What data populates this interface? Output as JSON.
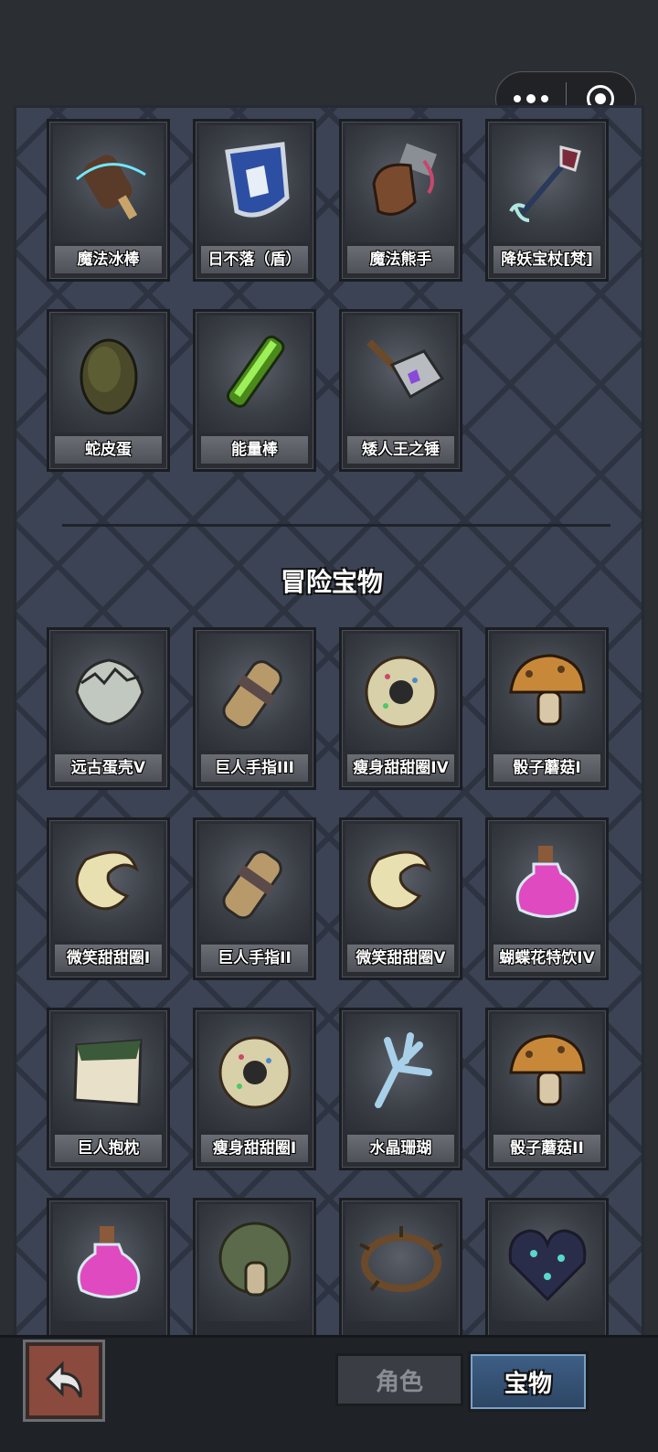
{
  "top_items": [
    {
      "label": "魔法冰棒",
      "icon": "ice-pop-icon"
    },
    {
      "label": "日不落（盾）",
      "icon": "shield-icon"
    },
    {
      "label": "魔法熊手",
      "icon": "bear-paw-icon"
    },
    {
      "label": "降妖宝杖[梵]",
      "icon": "staff-icon"
    },
    {
      "label": "蛇皮蛋",
      "icon": "snake-egg-icon"
    },
    {
      "label": "能量棒",
      "icon": "energy-bar-icon"
    },
    {
      "label": "矮人王之锤",
      "icon": "hammer-icon"
    }
  ],
  "section_title": "冒险宝物",
  "adventure_items": [
    {
      "label": "远古蛋壳V",
      "icon": "eggshell-icon"
    },
    {
      "label": "巨人手指III",
      "icon": "giant-finger-icon"
    },
    {
      "label": "瘦身甜甜圈IV",
      "icon": "donut-icon"
    },
    {
      "label": "骰子蘑菇I",
      "icon": "dice-mushroom-icon"
    },
    {
      "label": "微笑甜甜圈I",
      "icon": "smile-donut-icon"
    },
    {
      "label": "巨人手指II",
      "icon": "giant-finger-icon"
    },
    {
      "label": "微笑甜甜圈V",
      "icon": "smile-donut-icon"
    },
    {
      "label": "蝴蝶花特饮IV",
      "icon": "potion-icon"
    },
    {
      "label": "巨人抱枕",
      "icon": "pillow-icon"
    },
    {
      "label": "瘦身甜甜圈I",
      "icon": "donut-icon"
    },
    {
      "label": "水晶珊瑚",
      "icon": "crystal-coral-icon"
    },
    {
      "label": "骰子蘑菇II",
      "icon": "dice-mushroom-icon"
    },
    {
      "label": "",
      "icon": "potion-icon"
    },
    {
      "label": "",
      "icon": "green-mushroom-icon"
    },
    {
      "label": "",
      "icon": "thorn-ring-icon"
    },
    {
      "label": "",
      "icon": "crystal-heart-icon"
    }
  ],
  "tabs": {
    "role": "角色",
    "treasure": "宝物"
  },
  "colors": {
    "panel": "#3b4354",
    "active_tab": "#3f5f86",
    "back_button": "#8a4a3e"
  }
}
